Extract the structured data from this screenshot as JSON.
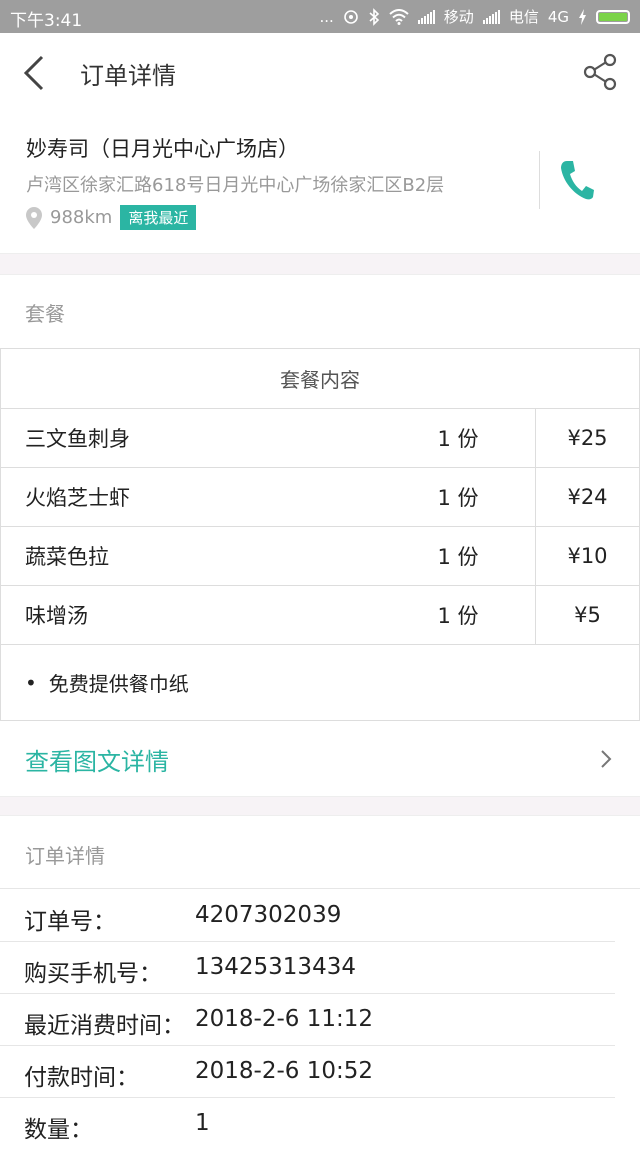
{
  "status_bar": {
    "time": "下午3:41",
    "dots": "...",
    "carrier1": "移动",
    "carrier2": "电信",
    "network": "4G"
  },
  "header": {
    "title": "订单详情",
    "back_icon": "chevron-left-icon",
    "share_icon": "share-icon"
  },
  "store": {
    "name": "妙寿司（日月光中心广场店）",
    "address": "卢湾区徐家汇路618号日月光中心广场徐家汇区B2层",
    "distance": "988km",
    "badge": "离我最近"
  },
  "package": {
    "section_title": "套餐",
    "table_header": "套餐内容",
    "items": [
      {
        "name": "三文鱼刺身",
        "qty": "1 份",
        "price": "¥25"
      },
      {
        "name": "火焰芝士虾",
        "qty": "1 份",
        "price": "¥24"
      },
      {
        "name": "蔬菜色拉",
        "qty": "1 份",
        "price": "¥10"
      },
      {
        "name": "味增汤",
        "qty": "1 份",
        "price": "¥5"
      }
    ],
    "note": "免费提供餐巾纸",
    "detail_link": "查看图文详情"
  },
  "order": {
    "section_title": "订单详情",
    "rows": [
      {
        "label": "订单号：",
        "value": "4207302039"
      },
      {
        "label": "购买手机号：",
        "value": "13425313434"
      },
      {
        "label": "最近消费时间：",
        "value": "2018-2-6 11:12"
      },
      {
        "label": "付款时间：",
        "value": "2018-2-6 10:52"
      },
      {
        "label": "数量：",
        "value": "1"
      }
    ]
  },
  "colors": {
    "accent": "#2bb5a3",
    "status_bar": "#9e9e9e",
    "section_gap": "#f7f3f6"
  }
}
